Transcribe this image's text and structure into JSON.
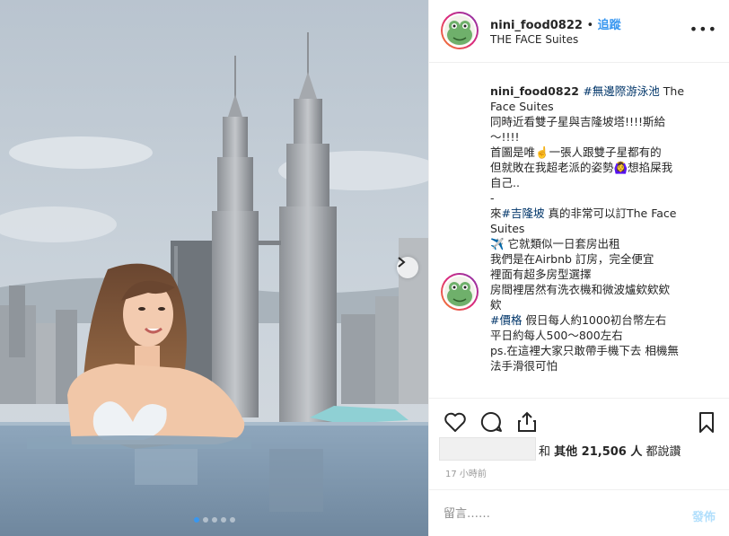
{
  "header": {
    "username": "nini_food0822",
    "separator": "•",
    "follow_label": "追蹤",
    "location": "THE FACE Suites",
    "more_icon": "more-dots-icon"
  },
  "caption": {
    "username": "nini_food0822",
    "lines": [
      {
        "tag": "#無邊際游泳池",
        "text": " The"
      },
      {
        "text": "Face Suites"
      },
      {
        "text": "同時近看雙子星與吉隆坡塔!!!!斯給"
      },
      {
        "text": "～!!!!"
      },
      {
        "text": "首圖是唯☝️一張人跟雙子星都有的"
      },
      {
        "text": "但就敗在我超老派的姿勢🙆‍♀️想掐屎我"
      },
      {
        "text": "自己.."
      },
      {
        "text": "-"
      },
      {
        "pre": "來",
        "tag": "#吉隆坡",
        "text": " 真的非常可以訂The Face"
      },
      {
        "text": "Suites"
      },
      {
        "text": "✈️ 它就類似一日套房出租"
      },
      {
        "text": "我們是在Airbnb 訂房，完全便宜"
      },
      {
        "text": "裡面有超多房型選擇"
      },
      {
        "text": "房間裡居然有洗衣機和微波爐欸欸欸"
      },
      {
        "text": "欸"
      },
      {
        "tag": "#價格",
        "text": " 假日每人約1000初台幣左右"
      },
      {
        "text": "平日約每人500～800左右"
      },
      {
        "text": "ps.在這裡大家只敢帶手機下去 相機無"
      },
      {
        "text": "法手滑很可怕"
      }
    ]
  },
  "actions": {
    "like_icon": "heart-icon",
    "comment_icon": "comment-icon",
    "share_icon": "share-icon",
    "save_icon": "bookmark-icon"
  },
  "likes": {
    "prefix": "和 ",
    "others_label": "其他 21,506 人",
    "suffix": " 都說讚"
  },
  "timestamp": "17 小時前",
  "comment": {
    "placeholder": "留言……",
    "post_label": "發佈"
  },
  "carousel": {
    "total": 5,
    "active_index": 0
  },
  "colors": {
    "link_blue": "#3897f0",
    "hashtag": "#003569",
    "disabled_post": "#b2dffc",
    "muted": "#999999"
  }
}
